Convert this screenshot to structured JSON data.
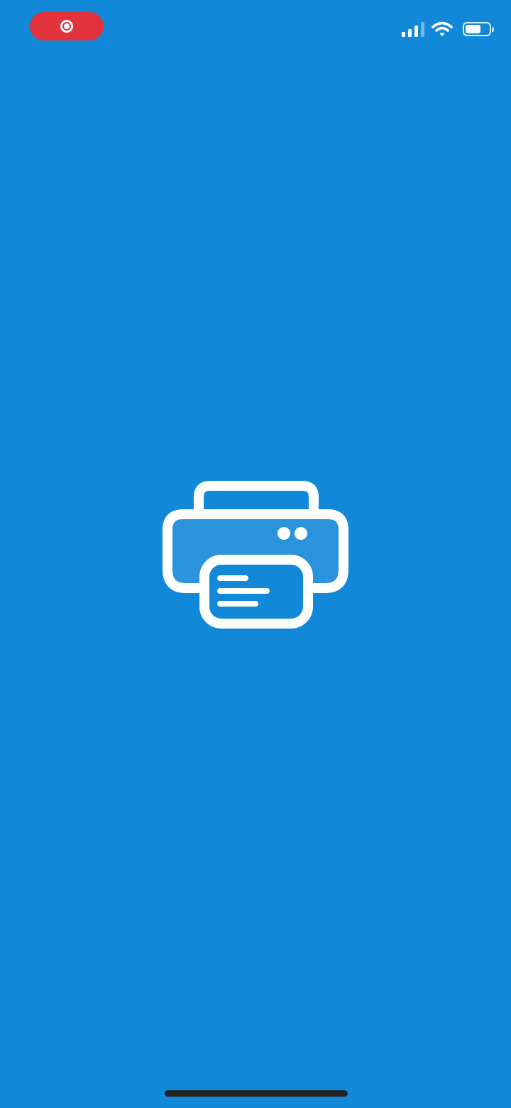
{
  "status_bar": {
    "recording_indicator": "recording-icon",
    "signal_icon": "cellular-signal-icon",
    "wifi_icon": "wifi-icon",
    "battery_icon": "battery-icon",
    "battery_level": 0.65
  },
  "splash": {
    "logo_icon": "printer-icon"
  },
  "colors": {
    "background": "#1289D8",
    "recording_pill": "#E2323C",
    "icon": "#FFFFFF",
    "home_indicator": "#222222"
  }
}
